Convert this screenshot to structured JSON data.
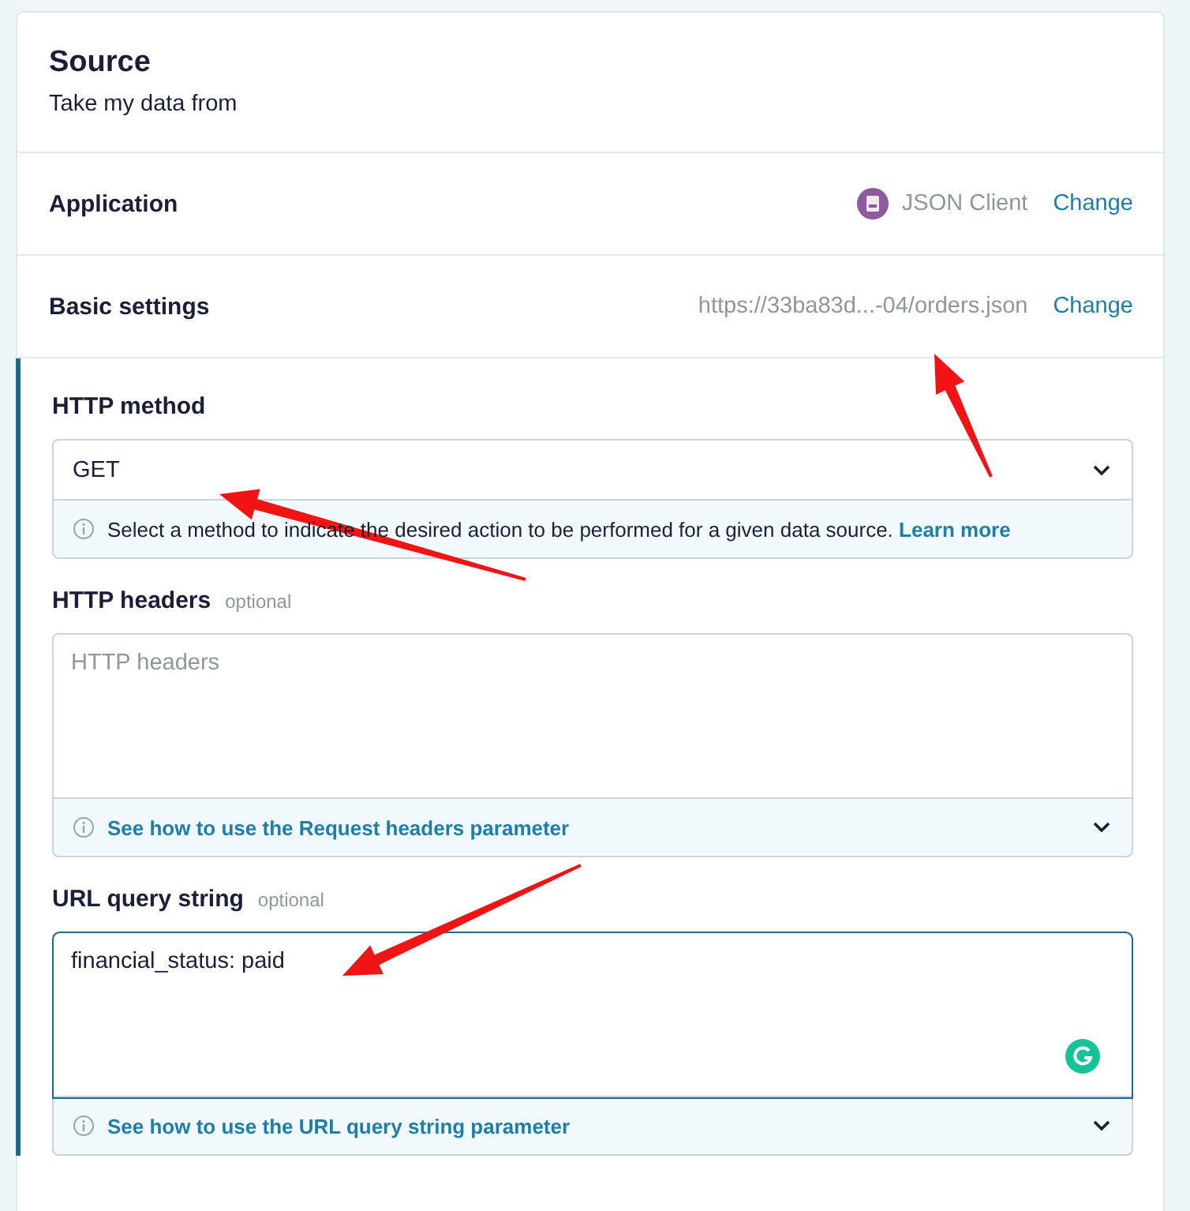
{
  "source": {
    "title": "Source",
    "subtitle": "Take my data from"
  },
  "summary_rows": [
    {
      "label": "Application",
      "value": "JSON Client",
      "has_app_icon": true,
      "action": "Change"
    },
    {
      "label": "Basic settings",
      "value": "https://33ba83d...-04/orders.json",
      "has_app_icon": false,
      "action": "Change"
    }
  ],
  "fields": [
    {
      "kind": "select",
      "label": "HTTP method",
      "value": "GET",
      "focused": false,
      "hint": {
        "text": "Select a method to indicate the desired action to be performed for a given data source.",
        "link": "Learn more",
        "expandable": false
      }
    },
    {
      "kind": "textarea",
      "label": "HTTP headers",
      "optional": "optional",
      "placeholder": "HTTP headers",
      "focused": false,
      "hint": {
        "link": "See how to use the Request headers parameter",
        "expandable": true
      }
    },
    {
      "kind": "textarea",
      "label": "URL query string",
      "optional": "optional",
      "value": "financial_status: paid",
      "focused": true,
      "hint": {
        "link": "See how to use the URL query string parameter",
        "expandable": true
      }
    }
  ]
}
